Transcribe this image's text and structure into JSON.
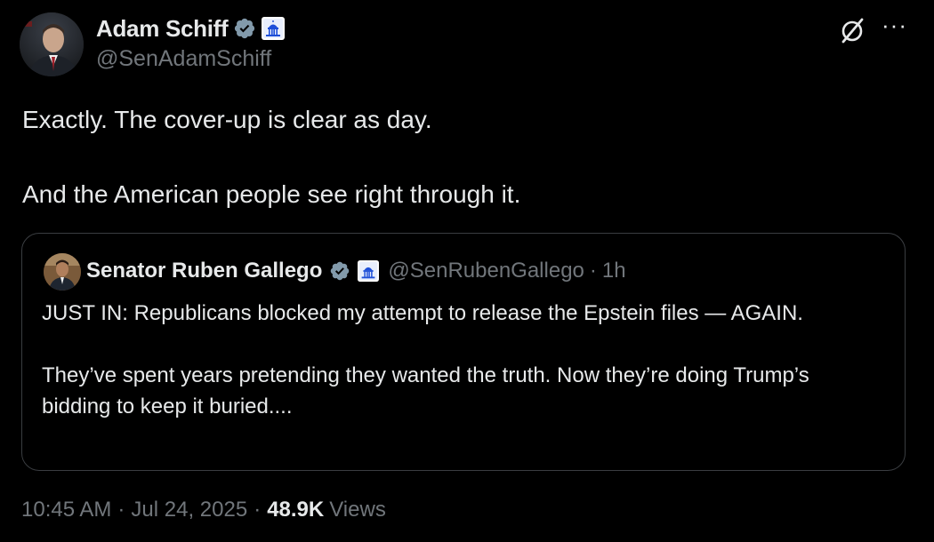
{
  "tweet": {
    "author": {
      "name": "Adam Schiff",
      "handle": "@SenAdamSchiff",
      "verified_color": "#829aab"
    },
    "body": [
      "Exactly. The cover-up is clear as day.",
      "And the American people see right through it."
    ],
    "icons": {
      "grok": "grok-icon",
      "more": "···"
    },
    "quote": {
      "author": {
        "name": "Senator Ruben Gallego",
        "handle": "@SenRubenGallego",
        "time": "1h"
      },
      "separator": "·",
      "body": [
        "JUST IN: Republicans blocked my attempt to release the Epstein files — AGAIN.",
        "They’ve spent years pretending they wanted the truth. Now they’re doing Trump’s bidding to keep it buried...."
      ]
    },
    "footer": {
      "time": "10:45 AM",
      "date": "Jul 24, 2025",
      "separator": "·",
      "views_count": "48.9K",
      "views_label": "Views"
    }
  },
  "colors": {
    "background": "#000000",
    "text": "#e7e9ea",
    "muted": "#71767b",
    "border": "#3a3d41",
    "gov_badge_bg": "#ffffff",
    "gov_badge_fg": "#1d4ed8"
  }
}
